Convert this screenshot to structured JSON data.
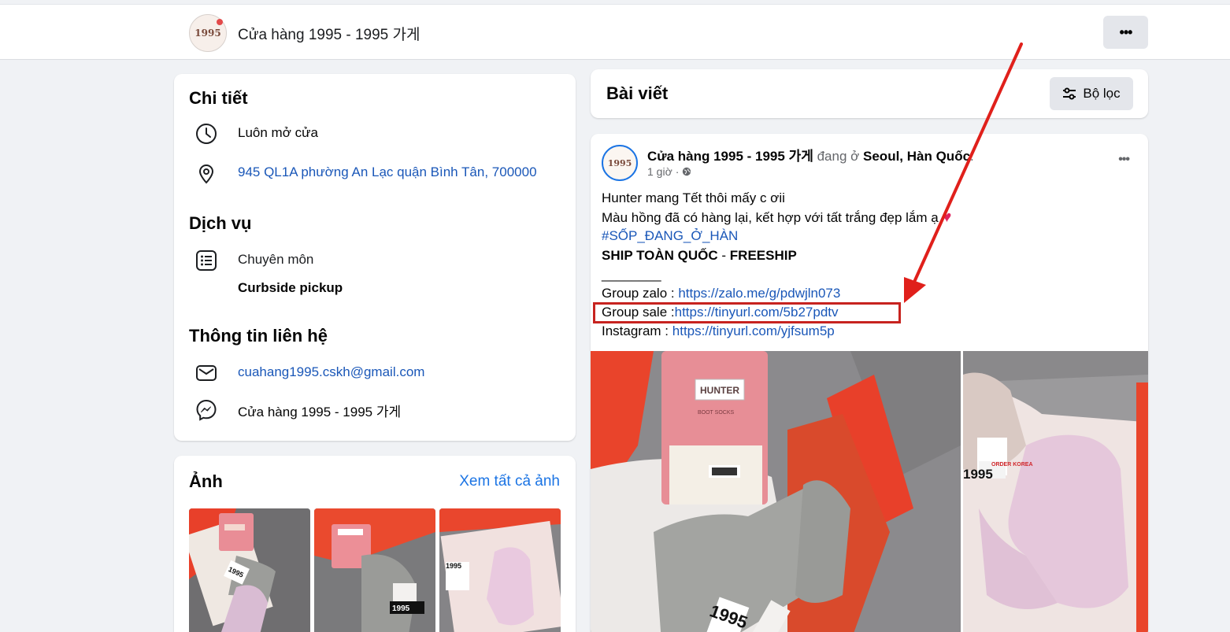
{
  "header": {
    "avatar_text": "1995",
    "page_name": "Cửa hàng 1995 - 1995 가게",
    "more_label": "•••"
  },
  "details": {
    "title": "Chi tiết",
    "hours": "Luôn mở cửa",
    "address": "945 QL1A phường An Lạc quận Bình Tân, 700000",
    "services_title": "Dịch vụ",
    "specialty_label": "Chuyên môn",
    "specialty_value": "Curbside pickup",
    "contact_title": "Thông tin liên hệ",
    "email": "cuahang1995.cskh@gmail.com",
    "messenger": "Cửa hàng 1995 - 1995 가게"
  },
  "photos": {
    "title": "Ảnh",
    "see_all": "Xem tất cả ảnh"
  },
  "posts": {
    "title": "Bài viết",
    "filter_label": "Bộ lọc"
  },
  "post": {
    "avatar_text": "1995",
    "author": "Cửa hàng 1995 - 1995 가게",
    "checkin_word": "đang ở",
    "location": "Seoul, Hàn Quốc",
    "time": "1 giờ",
    "more_label": "•••",
    "line1": "Hunter mang Tết thôi mấy c ơii",
    "line2": "Màu hồng đã có hàng lại, kết hợp với tất trắng đẹp lắm ạ",
    "line2_emoji": "♥",
    "hashtag": "#SỐP_ĐANG_Ở_HÀN",
    "ship_a": "SHIP TOÀN QUỐC",
    "ship_sep": " - ",
    "ship_b": "FREESHIP",
    "divider": "________",
    "zalo_label": "Group zalo : ",
    "zalo_url": "https://zalo.me/g/pdwjln073",
    "sale_label": "Group  sale :",
    "sale_url": "https://tinyurl.com/5b27pdtv",
    "insta_label": "Instagram : ",
    "insta_url": "https://tinyurl.com/yjfsum5p",
    "box_brand": "HUNTER",
    "box_sub": "BOOT SOCKS",
    "sticker_a": "1995",
    "sticker_b": "ORDER KOREA"
  },
  "colors": {
    "link": "#1a57b8",
    "accent": "#1b74e4",
    "highlight_box": "#c7231f",
    "arrow": "#e0201b"
  }
}
